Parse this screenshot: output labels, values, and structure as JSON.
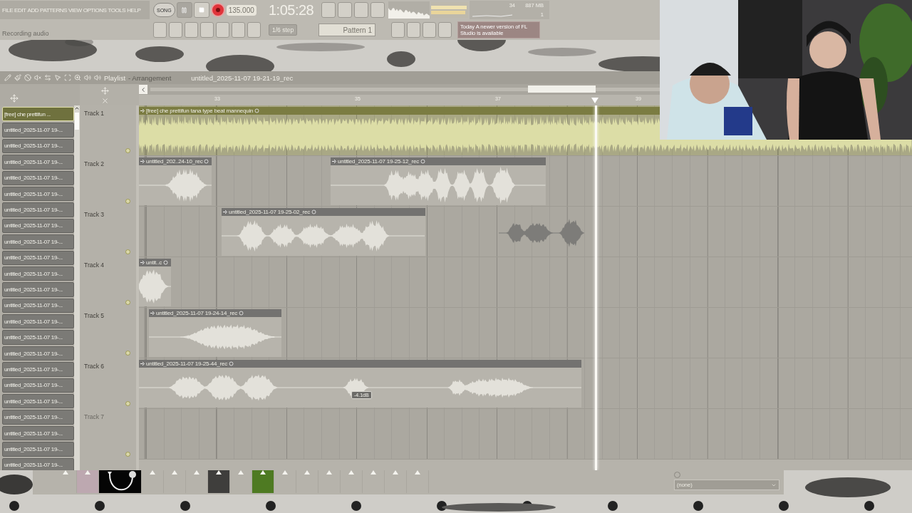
{
  "menu": [
    "FILE",
    "EDIT",
    "ADD",
    "PATTERNS",
    "VIEW",
    "OPTIONS",
    "TOOLS",
    "HELP"
  ],
  "hint": "Recording audio",
  "transport": {
    "mode": "SONG",
    "recording": true,
    "tempo": "135.000",
    "time": "1:05:28"
  },
  "snap": "1/6 step",
  "pattern": "Pattern 1",
  "news": {
    "label": "Today",
    "text": "A newer version of FL Studio is available"
  },
  "monitor": {
    "cpu": "34",
    "memory": "887 MB",
    "polyphony": "1"
  },
  "playlist": {
    "title": "Playlist",
    "subtitle": "- Arrangement",
    "file": "untitled_2025-11-07 19-21-19_rec",
    "ruler": [
      "33",
      "35",
      "37",
      "39"
    ],
    "picker": [
      {
        "label": "[free] che  prettifun ...",
        "selected": true
      },
      {
        "label": "untitled_2025-11-07 19-...",
        "selected": false
      },
      {
        "label": "untitled_2025-11-07 19-...",
        "selected": false
      },
      {
        "label": "untitled_2025-11-07 19-...",
        "selected": false
      },
      {
        "label": "untitled_2025-11-07 19-...",
        "selected": false
      },
      {
        "label": "untitled_2025-11-07 19-...",
        "selected": false
      },
      {
        "label": "untitled_2025-11-07 19-...",
        "selected": false
      },
      {
        "label": "untitled_2025-11-07 19-...",
        "selected": false
      },
      {
        "label": "untitled_2025-11-07 19-...",
        "selected": false
      },
      {
        "label": "untitled_2025-11-07 19-...",
        "selected": false
      },
      {
        "label": "untitled_2025-11-07 19-...",
        "selected": false
      },
      {
        "label": "untitled_2025-11-07 19-...",
        "selected": false
      },
      {
        "label": "untitled_2025-11-07 19-...",
        "selected": false
      },
      {
        "label": "untitled_2025-11-07 19-...",
        "selected": false
      },
      {
        "label": "untitled_2025-11-07 19-...",
        "selected": false
      },
      {
        "label": "untitled_2025-11-07 19-...",
        "selected": false
      },
      {
        "label": "untitled_2025-11-07 19-...",
        "selected": false
      },
      {
        "label": "untitled_2025-11-07 19-...",
        "selected": false
      },
      {
        "label": "untitled_2025-11-07 19-...",
        "selected": false
      },
      {
        "label": "untitled_2025-11-07 19-...",
        "selected": false
      },
      {
        "label": "untitled_2025-11-07 19-...",
        "selected": false
      },
      {
        "label": "untitled_2025-11-07 19-...",
        "selected": false
      },
      {
        "label": "untitled_2025-11-07 19-...",
        "selected": false
      }
    ],
    "tracks": [
      {
        "name": "Track 1",
        "empty": false,
        "clips": [
          {
            "label": "[free] che  prettifun  tana type beat mannequin",
            "kind": "beat"
          }
        ]
      },
      {
        "name": "Track 2",
        "empty": false,
        "clips": [
          {
            "label": "untitled_202..24-10_rec",
            "kind": "audio"
          },
          {
            "label": "untitled_2025-11-07 19-25-12_rec",
            "kind": "audio"
          }
        ]
      },
      {
        "name": "Track 3",
        "empty": false,
        "clips": [
          {
            "label": "untitled_2025-11-07 19-25-02_rec",
            "kind": "audio"
          }
        ]
      },
      {
        "name": "Track 4",
        "empty": false,
        "clips": [
          {
            "label": "untit..c",
            "kind": "audio"
          }
        ]
      },
      {
        "name": "Track 5",
        "empty": false,
        "clips": [
          {
            "label": "untitled_2025-11-07 19-24-14_rec",
            "kind": "audio"
          }
        ]
      },
      {
        "name": "Track 6",
        "empty": false,
        "clips": [
          {
            "label": "untitled_2025-11-07 19-25-44_rec",
            "kind": "audio",
            "hint": "-4.1dB"
          }
        ]
      },
      {
        "name": "Track 7",
        "empty": true
      }
    ]
  },
  "mixer": [
    {
      "kind": "slot"
    },
    {
      "kind": "color",
      "color": "#bda8b0"
    },
    {
      "kind": "cable"
    },
    {
      "kind": "slot"
    },
    {
      "kind": "slot"
    },
    {
      "kind": "slot"
    },
    {
      "kind": "color",
      "color": "#3f3e3c"
    },
    {
      "kind": "slot"
    },
    {
      "kind": "color",
      "color": "#4e7a22"
    },
    {
      "kind": "slot"
    },
    {
      "kind": "slot"
    },
    {
      "kind": "slot"
    },
    {
      "kind": "slot"
    },
    {
      "kind": "slot"
    },
    {
      "kind": "slot"
    },
    {
      "kind": "slot"
    }
  ],
  "selector": "(none)"
}
